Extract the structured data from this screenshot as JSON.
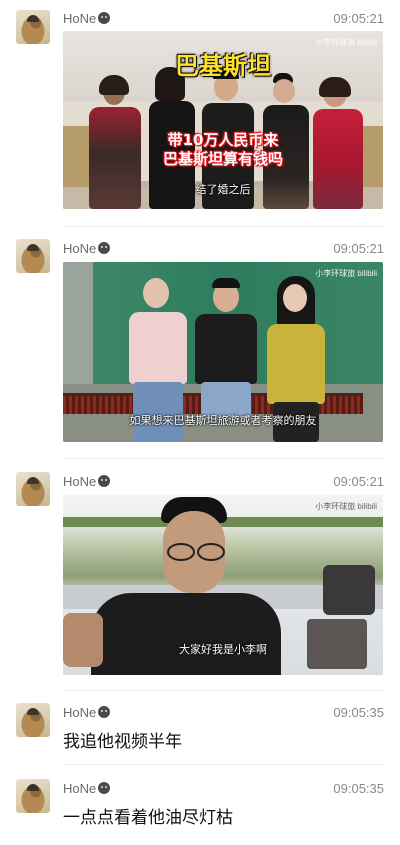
{
  "messages": [
    {
      "sender": "HoNe",
      "time": "09:05:21",
      "type": "video",
      "video": {
        "watermark": "小李环球旅 bilibili",
        "title": "巴基斯坦",
        "caption_line1": "带10万人民币来",
        "caption_line2": "巴基斯坦算有钱吗",
        "subtitle": "结了婚之后"
      }
    },
    {
      "sender": "HoNe",
      "time": "09:05:21",
      "type": "video",
      "video": {
        "watermark": "小李环球旅 bilibili",
        "subtitle": "如果想来巴基斯坦旅游或者考察的朋友"
      }
    },
    {
      "sender": "HoNe",
      "time": "09:05:21",
      "type": "video",
      "video": {
        "watermark": "小李环球旅 bilibili",
        "subtitle": "大家好我是小李啊"
      }
    },
    {
      "sender": "HoNe",
      "time": "09:05:35",
      "type": "text",
      "text": "我追他视频半年"
    },
    {
      "sender": "HoNe",
      "time": "09:05:35",
      "type": "text",
      "text": "一点点看着他油尽灯枯"
    }
  ],
  "icons": {
    "avatar": "user-avatar-icon",
    "sender_badge": "face-badge-icon"
  },
  "colors": {
    "background": "#ffffff",
    "name": "#6b6b6b",
    "time": "#8a8a8a",
    "caption_yellow": "#ffe02a",
    "caption_red": "#e8161d"
  }
}
